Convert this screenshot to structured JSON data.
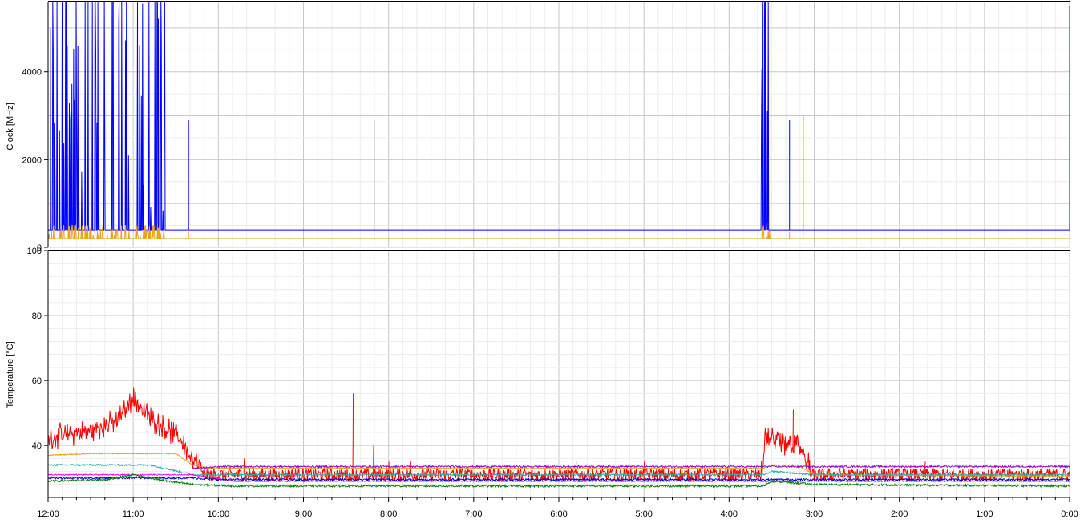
{
  "colors": {
    "grid_major": "#c8c8c8",
    "grid_minor": "#ececec",
    "axis": "#000000",
    "blue": "#0000ff",
    "orange": "#e8a317",
    "red": "#ff0000",
    "purple": "#9400d3",
    "teal": "#20b2aa",
    "green": "#008000",
    "magenta": "#ff00ff",
    "navy": "#0000cd"
  },
  "chart_data": [
    {
      "type": "line",
      "ylabel": "Clock [MHz]",
      "ylim": [
        0,
        5600
      ],
      "yticks": [
        0,
        2000,
        4000
      ],
      "ytick_labels": [
        "0",
        "2000",
        "4000"
      ],
      "xlim_hours_ago": [
        12,
        0
      ],
      "series": [
        {
          "color": "blue",
          "baseline": 400,
          "bursts": [
            {
              "start": 12.0,
              "end": 11.48,
              "peak": 5600,
              "density": 0.85
            },
            {
              "start": 11.45,
              "end": 11.05,
              "peak": 5600,
              "density": 0.65
            },
            {
              "start": 10.95,
              "end": 10.62,
              "peak": 5600,
              "density": 0.75
            },
            {
              "start": 3.62,
              "end": 3.52,
              "peak": 5600,
              "density": 0.9
            }
          ],
          "spikes": [
            {
              "x": 10.35,
              "y": 2900
            },
            {
              "x": 8.17,
              "y": 2900
            },
            {
              "x": 3.32,
              "y": 5500
            },
            {
              "x": 3.29,
              "y": 2900
            },
            {
              "x": 3.13,
              "y": 3000
            },
            {
              "x": 0.0,
              "y": 5500
            }
          ]
        },
        {
          "color": "orange",
          "baseline": 200,
          "bursts": [
            {
              "start": 12.0,
              "end": 10.62,
              "peak": 500,
              "density": 0.7
            },
            {
              "start": 3.62,
              "end": 3.52,
              "peak": 500,
              "density": 0.8
            }
          ],
          "spikes": [
            {
              "x": 10.35,
              "y": 400
            },
            {
              "x": 8.17,
              "y": 350
            },
            {
              "x": 3.32,
              "y": 400
            },
            {
              "x": 3.29,
              "y": 350
            },
            {
              "x": 3.13,
              "y": 350
            }
          ]
        }
      ]
    },
    {
      "type": "line",
      "ylabel": "Temperature [°C]",
      "ylim": [
        24,
        100
      ],
      "yticks": [
        40,
        60,
        80,
        100
      ],
      "ytick_labels": [
        "40",
        "60",
        "80",
        "100"
      ],
      "xlabel": "",
      "x_ticks": [
        12,
        11,
        10,
        9,
        8,
        7,
        6,
        5,
        4,
        3,
        2,
        1,
        0
      ],
      "x_tick_labels": [
        "12:00",
        "11:00",
        "10:00",
        "9:00",
        "8:00",
        "7:00",
        "6:00",
        "5:00",
        "4:00",
        "3:00",
        "2:00",
        "1:00",
        "0:00"
      ],
      "series": [
        {
          "color": "red",
          "profile": [
            [
              12,
              40
            ],
            [
              11.5,
              42
            ],
            [
              11.2,
              45
            ],
            [
              11.0,
              52
            ],
            [
              10.8,
              46
            ],
            [
              10.45,
              40
            ],
            [
              10.3,
              33
            ],
            [
              10.2,
              31
            ],
            [
              3.6,
              31
            ],
            [
              3.58,
              40
            ],
            [
              3.4,
              38
            ],
            [
              3.2,
              38
            ],
            [
              3.05,
              31
            ],
            [
              0,
              31
            ]
          ],
          "noise": 4,
          "spikes": [
            {
              "x": 8.42,
              "y": 56
            },
            {
              "x": 8.18,
              "y": 40
            },
            {
              "x": 3.25,
              "y": 51
            },
            {
              "x": 11.0,
              "y": 58
            },
            {
              "x": 9.7,
              "y": 36
            },
            {
              "x": 8.0,
              "y": 35
            },
            {
              "x": 7.75,
              "y": 35
            },
            {
              "x": 5.8,
              "y": 35
            },
            {
              "x": 5.0,
              "y": 35
            },
            {
              "x": 1.7,
              "y": 35
            },
            {
              "x": 0.0,
              "y": 36
            }
          ]
        },
        {
          "color": "orange",
          "profile": [
            [
              12,
              37
            ],
            [
              11.5,
              37.5
            ],
            [
              10.5,
              37.5
            ],
            [
              10.3,
              34
            ],
            [
              10.1,
              33
            ],
            [
              3.6,
              33
            ],
            [
              3.5,
              34
            ],
            [
              3.2,
              34
            ],
            [
              3.0,
              31
            ],
            [
              0,
              30.5
            ]
          ],
          "noise": 0.3
        },
        {
          "color": "purple",
          "profile": [
            [
              10.3,
              33
            ],
            [
              9.9,
              33.5
            ],
            [
              0,
              33.5
            ]
          ],
          "noise": 0.5
        },
        {
          "color": "teal",
          "profile": [
            [
              12,
              34
            ],
            [
              10.8,
              34
            ],
            [
              10.3,
              31
            ],
            [
              3.6,
              31
            ],
            [
              3.5,
              32
            ],
            [
              3.0,
              31
            ],
            [
              0,
              31
            ]
          ],
          "noise": 0.5
        },
        {
          "color": "magenta",
          "profile": [
            [
              12,
              31
            ],
            [
              10.3,
              31
            ],
            [
              9.8,
              29
            ],
            [
              0,
              29
            ]
          ],
          "noise": 0.3
        },
        {
          "color": "navy",
          "profile": [
            [
              12,
              30
            ],
            [
              10.3,
              30
            ],
            [
              10.0,
              29.5
            ],
            [
              0,
              29.5
            ]
          ],
          "noise": 0.6
        },
        {
          "color": "green",
          "profile": [
            [
              12,
              29
            ],
            [
              11.3,
              29.5
            ],
            [
              11.0,
              31
            ],
            [
              10.6,
              29
            ],
            [
              10.3,
              28
            ],
            [
              9.8,
              27.5
            ],
            [
              3.6,
              27.5
            ],
            [
              3.5,
              29
            ],
            [
              3.0,
              28
            ],
            [
              0,
              27.5
            ]
          ],
          "noise": 0.6
        }
      ]
    }
  ]
}
